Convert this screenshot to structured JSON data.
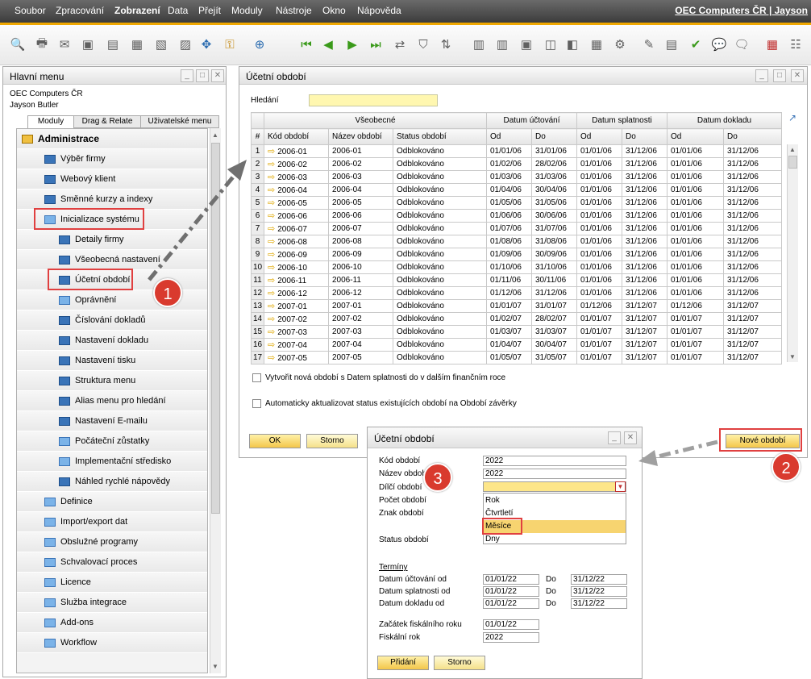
{
  "menu": {
    "items": [
      "Soubor",
      "Zpracování",
      "Zobrazení",
      "Data",
      "Přejít",
      "Moduly",
      "Nástroje",
      "Okno",
      "Nápověda"
    ],
    "company": "OEC Computers ČR | Jayson"
  },
  "main_menu": {
    "title": "Hlavní menu",
    "company": "OEC Computers ČR",
    "user": "Jayson Butler",
    "tabs": [
      "Moduly",
      "Drag & Relate",
      "Uživatelské menu"
    ],
    "items": [
      {
        "label": "Administrace"
      },
      {
        "label": "Výběr firmy"
      },
      {
        "label": "Webový klient"
      },
      {
        "label": "Směnné kurzy a indexy"
      },
      {
        "label": "Inicializace systému"
      },
      {
        "label": "Detaily firmy"
      },
      {
        "label": "Všeobecná nastavení"
      },
      {
        "label": "Účetní období"
      },
      {
        "label": "Oprávnění"
      },
      {
        "label": "Číslování dokladů"
      },
      {
        "label": "Nastavení dokladu"
      },
      {
        "label": "Nastavení tisku"
      },
      {
        "label": "Struktura menu"
      },
      {
        "label": "Alias menu pro hledání"
      },
      {
        "label": "Nastavení E-mailu"
      },
      {
        "label": "Počáteční zůstatky"
      },
      {
        "label": "Implementační středisko"
      },
      {
        "label": "Náhled rychlé nápovědy"
      },
      {
        "label": "Definice"
      },
      {
        "label": "Import/export dat"
      },
      {
        "label": "Obslužné programy"
      },
      {
        "label": "Schvalovací proces"
      },
      {
        "label": "Licence"
      },
      {
        "label": "Služba integrace"
      },
      {
        "label": "Add-ons"
      },
      {
        "label": "Workflow"
      }
    ]
  },
  "periods_window": {
    "title": "Účetní období",
    "search_label": "Hledání",
    "group_headers": [
      "Všeobecné",
      "Datum účtování",
      "Datum splatnosti",
      "Datum dokladu"
    ],
    "columns": [
      "#",
      "Kód období",
      "Název období",
      "Status období",
      "Od",
      "Do",
      "Od",
      "Do",
      "Od",
      "Do"
    ],
    "rows": [
      [
        "1",
        "2006-01",
        "2006-01",
        "Odblokováno",
        "01/01/06",
        "31/01/06",
        "01/01/06",
        "31/12/06",
        "01/01/06",
        "31/12/06"
      ],
      [
        "2",
        "2006-02",
        "2006-02",
        "Odblokováno",
        "01/02/06",
        "28/02/06",
        "01/01/06",
        "31/12/06",
        "01/01/06",
        "31/12/06"
      ],
      [
        "3",
        "2006-03",
        "2006-03",
        "Odblokováno",
        "01/03/06",
        "31/03/06",
        "01/01/06",
        "31/12/06",
        "01/01/06",
        "31/12/06"
      ],
      [
        "4",
        "2006-04",
        "2006-04",
        "Odblokováno",
        "01/04/06",
        "30/04/06",
        "01/01/06",
        "31/12/06",
        "01/01/06",
        "31/12/06"
      ],
      [
        "5",
        "2006-05",
        "2006-05",
        "Odblokováno",
        "01/05/06",
        "31/05/06",
        "01/01/06",
        "31/12/06",
        "01/01/06",
        "31/12/06"
      ],
      [
        "6",
        "2006-06",
        "2006-06",
        "Odblokováno",
        "01/06/06",
        "30/06/06",
        "01/01/06",
        "31/12/06",
        "01/01/06",
        "31/12/06"
      ],
      [
        "7",
        "2006-07",
        "2006-07",
        "Odblokováno",
        "01/07/06",
        "31/07/06",
        "01/01/06",
        "31/12/06",
        "01/01/06",
        "31/12/06"
      ],
      [
        "8",
        "2006-08",
        "2006-08",
        "Odblokováno",
        "01/08/06",
        "31/08/06",
        "01/01/06",
        "31/12/06",
        "01/01/06",
        "31/12/06"
      ],
      [
        "9",
        "2006-09",
        "2006-09",
        "Odblokováno",
        "01/09/06",
        "30/09/06",
        "01/01/06",
        "31/12/06",
        "01/01/06",
        "31/12/06"
      ],
      [
        "10",
        "2006-10",
        "2006-10",
        "Odblokováno",
        "01/10/06",
        "31/10/06",
        "01/01/06",
        "31/12/06",
        "01/01/06",
        "31/12/06"
      ],
      [
        "11",
        "2006-11",
        "2006-11",
        "Odblokováno",
        "01/11/06",
        "30/11/06",
        "01/01/06",
        "31/12/06",
        "01/01/06",
        "31/12/06"
      ],
      [
        "12",
        "2006-12",
        "2006-12",
        "Odblokováno",
        "01/12/06",
        "31/12/06",
        "01/01/06",
        "31/12/06",
        "01/01/06",
        "31/12/06"
      ],
      [
        "13",
        "2007-01",
        "2007-01",
        "Odblokováno",
        "01/01/07",
        "31/01/07",
        "01/12/06",
        "31/12/07",
        "01/12/06",
        "31/12/07"
      ],
      [
        "14",
        "2007-02",
        "2007-02",
        "Odblokováno",
        "01/02/07",
        "28/02/07",
        "01/01/07",
        "31/12/07",
        "01/01/07",
        "31/12/07"
      ],
      [
        "15",
        "2007-03",
        "2007-03",
        "Odblokováno",
        "01/03/07",
        "31/03/07",
        "01/01/07",
        "31/12/07",
        "01/01/07",
        "31/12/07"
      ],
      [
        "16",
        "2007-04",
        "2007-04",
        "Odblokováno",
        "01/04/07",
        "30/04/07",
        "01/01/07",
        "31/12/07",
        "01/01/07",
        "31/12/07"
      ],
      [
        "17",
        "2007-05",
        "2007-05",
        "Odblokováno",
        "01/05/07",
        "31/05/07",
        "01/01/07",
        "31/12/07",
        "01/01/07",
        "31/12/07"
      ]
    ],
    "checkbox1": "Vytvořit nová období s Datem splatnosti do v dalším finančním roce",
    "checkbox2": "Automaticky aktualizovat status existujících období na Období závěrky",
    "ok": "OK",
    "cancel": "Storno",
    "new_period": "Nové období"
  },
  "dialog": {
    "title": "Účetní období",
    "code_label": "Kód období",
    "code_value": "2022",
    "name_label": "Název období",
    "name_value": "2022",
    "sub_label": "Dílčí období",
    "count_label": "Počet období",
    "sign_label": "Znak období",
    "status_label": "Status období",
    "options": [
      "Rok",
      "Čtvrtletí",
      "Měsíce",
      "Dny"
    ],
    "terms_label": "Termíny",
    "posting_label": "Datum účtování od",
    "due_label": "Datum splatnosti od",
    "doc_label": "Datum dokladu od",
    "to_label": "Do",
    "posting_from": "01/01/22",
    "posting_to": "31/12/22",
    "due_from": "01/01/22",
    "due_to": "31/12/22",
    "doc_from": "01/01/22",
    "doc_to": "31/12/22",
    "fy_start_label": "Začátek fiskálního roku",
    "fy_start": "01/01/22",
    "fy_label": "Fiskální rok",
    "fy": "2022",
    "add": "Přidání",
    "cancel": "Storno"
  },
  "badges": [
    "1",
    "2",
    "3"
  ],
  "colors": {
    "accent": "#f0a800",
    "highlight": "#e04040",
    "selection": "#f7d470"
  }
}
